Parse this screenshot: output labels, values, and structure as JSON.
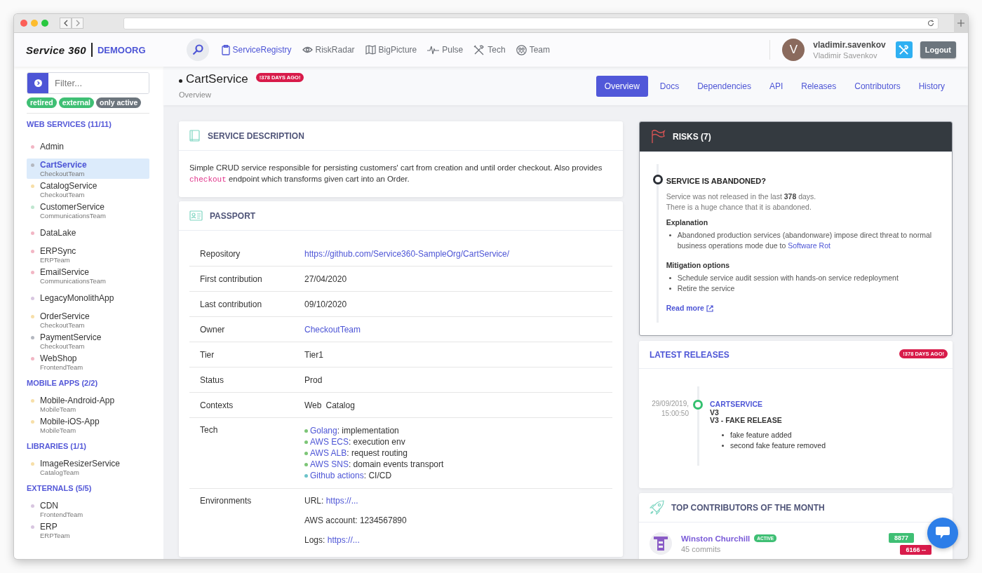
{
  "header": {
    "logo": "Service 360",
    "org": "DEMOORG",
    "nav": [
      {
        "label": "ServiceRegistry",
        "kind": "clipboard",
        "selected": true
      },
      {
        "label": "RiskRadar",
        "kind": "eye",
        "selected": false
      },
      {
        "label": "BigPicture",
        "kind": "map",
        "selected": false
      },
      {
        "label": "Pulse",
        "kind": "pulse",
        "selected": false
      },
      {
        "label": "Tech",
        "kind": "tools",
        "selected": false
      },
      {
        "label": "Team",
        "kind": "team",
        "selected": false
      }
    ],
    "user": {
      "initial": "V",
      "login": "vladimir.savenkov",
      "name": "Vladimir Savenkov"
    },
    "logout": "Logout"
  },
  "sidebar": {
    "filter_placeholder": "Filter...",
    "tags": [
      {
        "label": "retired",
        "on": true
      },
      {
        "label": "external",
        "on": true
      },
      {
        "label": "only active",
        "on": false
      }
    ],
    "groups": [
      {
        "title": "WEB SERVICES (11/11)",
        "items": [
          {
            "name": "Admin",
            "color": "#f2b6c4",
            "selected": false
          },
          {
            "name": "CartService",
            "team": "CheckoutTeam",
            "color": "#b4b8c0",
            "selected": true
          },
          {
            "name": "CatalogService",
            "team": "CheckoutTeam",
            "color": "#f7dfa8",
            "selected": false
          },
          {
            "name": "CustomerService",
            "team": "CommunicationsTeam",
            "color": "#bfe6cf",
            "selected": false
          },
          {
            "name": "DataLake",
            "color": "#f2b6c4",
            "selected": false
          },
          {
            "name": "ERPSync",
            "team": "ERPTeam",
            "color": "#f2b6c4",
            "selected": false
          },
          {
            "name": "EmailService",
            "team": "CommunicationsTeam",
            "color": "#f2b6c4",
            "selected": false
          },
          {
            "name": "LegacyMonolithApp",
            "color": "#d8c6e0",
            "selected": false
          },
          {
            "name": "OrderService",
            "team": "CheckoutTeam",
            "color": "#f7dfa8",
            "selected": false
          },
          {
            "name": "PaymentService",
            "team": "CheckoutTeam",
            "color": "#b4b8c0",
            "selected": false
          },
          {
            "name": "WebShop",
            "team": "FrontendTeam",
            "color": "#f2b6c4",
            "selected": false
          }
        ]
      },
      {
        "title": "MOBILE APPS (2/2)",
        "items": [
          {
            "name": "Mobile-Android-App",
            "team": "MobileTeam",
            "color": "#f7dfa8",
            "selected": false
          },
          {
            "name": "Mobile-iOS-App",
            "team": "MobileTeam",
            "color": "#f7dfa8",
            "selected": false
          }
        ]
      },
      {
        "title": "LIBRARIES (1/1)",
        "items": [
          {
            "name": "ImageResizerService",
            "team": "CatalogTeam",
            "color": "#f7dfa8",
            "selected": false
          }
        ]
      },
      {
        "title": "EXTERNALS (5/5)",
        "items": [
          {
            "name": "CDN",
            "team": "FrontendTeam",
            "color": "#d8c6e0",
            "selected": false
          },
          {
            "name": "ERP",
            "team": "ERPTeam",
            "color": "#d8c6e0",
            "selected": false
          }
        ]
      }
    ]
  },
  "page": {
    "title": "CartService",
    "badge": "!378 DAYS AGO!",
    "subtitle": "Overview",
    "tabs": [
      {
        "label": "Overview",
        "selected": true
      },
      {
        "label": "Docs",
        "selected": false
      },
      {
        "label": "Dependencies",
        "selected": false
      },
      {
        "label": "API",
        "selected": false
      },
      {
        "label": "Releases",
        "selected": false
      },
      {
        "label": "Contributors",
        "selected": false
      },
      {
        "label": "History",
        "selected": false
      }
    ]
  },
  "description": {
    "title": "SERVICE DESCRIPTION",
    "before": "Simple CRUD service responsible for persisting customers' cart from creation and until order checkout. Also provides",
    "code": "checkout",
    "after": "endpoint which transforms given cart into an Order."
  },
  "passport": {
    "title": "PASSPORT",
    "rows": [
      {
        "label": "Repository",
        "kind": "link",
        "value": "https://github.com/Service360-SampleOrg/CartService/"
      },
      {
        "label": "First contribution",
        "kind": "text",
        "value": "27/04/2020"
      },
      {
        "label": "Last contribution",
        "kind": "text",
        "value": "09/10/2020"
      },
      {
        "label": "Owner",
        "kind": "link",
        "value": "CheckoutTeam"
      },
      {
        "label": "Tier",
        "kind": "text",
        "value": "Tier1"
      },
      {
        "label": "Status",
        "kind": "text",
        "value": "Prod"
      },
      {
        "label": "Contexts",
        "kind": "tags",
        "values": [
          "Web",
          "Catalog"
        ]
      },
      {
        "label": "Tech",
        "kind": "tech",
        "items": [
          {
            "name": "Golang",
            "use": ": implementation",
            "color": "#7cc576"
          },
          {
            "name": "AWS ECS",
            "use": ": execution env",
            "color": "#7cc576"
          },
          {
            "name": "AWS ALB",
            "use": ": request routing",
            "color": "#7cc576"
          },
          {
            "name": "AWS SNS",
            "use": ": domain events transport",
            "color": "#7cc576"
          },
          {
            "name": "Github actions",
            "use": ": CI/CD",
            "color": "#6cc3c9"
          }
        ]
      },
      {
        "label": "Environments",
        "kind": "lines",
        "lines": [
          {
            "text": "URL:",
            "link": "https://..."
          },
          {
            "text": "AWS account: 1234567890"
          },
          {
            "text": "Logs:",
            "link": "https://..."
          }
        ]
      }
    ]
  },
  "risks": {
    "title": "RISKS (7)",
    "items": [
      {
        "title": "SERVICE IS ABANDONED?",
        "lines": [
          "Service was not released in the last **378** days.",
          "There is a huge chance that it is abandoned."
        ],
        "explanation_title": "Explanation",
        "explanation": {
          "text": "Abandoned production services (abandonware) impose direct threat to normal business operations mode due to",
          "link": "Software Rot"
        },
        "mitigation_title": "Mitigation options",
        "mitigation": [
          "Schedule service audit session with hands-on service redeployment",
          "Retire the service"
        ],
        "read_more": "Read more"
      }
    ]
  },
  "releases": {
    "title": "LATEST RELEASES",
    "badge": "!378 DAYS AGO!",
    "items": [
      {
        "date": "29/09/2019,",
        "time": "15:00:50",
        "service": "CARTSERVICE",
        "version": "V3",
        "title": "V3 - FAKE RELEASE",
        "notes": [
          "fake feature added",
          "second fake feature removed"
        ]
      }
    ]
  },
  "contributors": {
    "title": "TOP CONTRIBUTORS OF THE MONTH",
    "items": [
      {
        "name": "Winston Churchill",
        "status": "ACTIVE",
        "commits": "45 commits",
        "added": "8877",
        "removed": "6166 --"
      }
    ]
  }
}
